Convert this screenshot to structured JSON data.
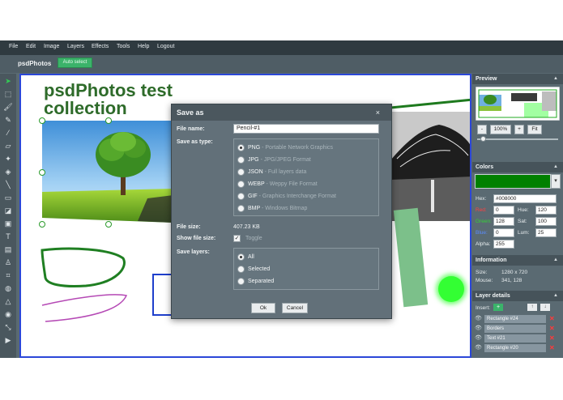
{
  "menu": [
    "File",
    "Edit",
    "Image",
    "Layers",
    "Effects",
    "Tools",
    "Help",
    "Logout"
  ],
  "app": {
    "brand": "psdPhotos",
    "auto_select": "Auto select"
  },
  "canvas": {
    "title_line1": "psdPhotos test",
    "title_line2": "collection"
  },
  "tools": [
    "select-icon",
    "marquee-icon",
    "brush-icon",
    "pencil-icon",
    "pipette-icon",
    "eraser-icon",
    "magic-wand-icon",
    "fill-icon",
    "line-icon",
    "rectangle-icon",
    "gradient-icon",
    "image-icon",
    "text-icon",
    "gradient-fill-icon",
    "stamp-icon",
    "crop-icon",
    "blur-icon",
    "sharpen-icon",
    "desaturate-icon",
    "bulge-icon",
    "animate-icon"
  ],
  "preview": {
    "title": "Preview",
    "minus": "-",
    "zoom": "100%",
    "plus": "+",
    "fit": "Fit",
    "zoom_level": 1.0
  },
  "colors": {
    "title": "Colors",
    "swatch": "#008000",
    "hex_label": "Hex:",
    "hex": "#008000",
    "red_label": "Red:",
    "red": "0",
    "green_label": "Green:",
    "green": "128",
    "blue_label": "Blue:",
    "blue": "0",
    "alpha_label": "Alpha:",
    "alpha": "255",
    "hue_label": "Hue:",
    "hue": "120",
    "sat_label": "Sat:",
    "sat": "100",
    "lum_label": "Lum:",
    "lum": "25"
  },
  "information": {
    "title": "Information",
    "size_label": "Size:",
    "size": "1280 x 720",
    "mouse_label": "Mouse:",
    "mouse": "341, 128"
  },
  "layers": {
    "title": "Layer details",
    "insert_label": "Insert:",
    "items": [
      {
        "name": "Rectangle #24"
      },
      {
        "name": "Borders"
      },
      {
        "name": "Text #21"
      },
      {
        "name": "Rectangle #20"
      }
    ]
  },
  "dialog": {
    "title": "Save as",
    "close": "×",
    "file_name_label": "File name:",
    "file_name": "Pencil-#1",
    "save_as_type_label": "Save as type:",
    "types": [
      {
        "name": "PNG",
        "desc": " - Portable Network Graphics",
        "selected": true
      },
      {
        "name": "JPG",
        "desc": " - JPG/JPEG Format",
        "selected": false
      },
      {
        "name": "JSON",
        "desc": " - Full layers data",
        "selected": false
      },
      {
        "name": "WEBP",
        "desc": " - Weppy File Format",
        "selected": false
      },
      {
        "name": "GIF",
        "desc": " - Graphics Interchange Format",
        "selected": false
      },
      {
        "name": "BMP",
        "desc": " - Windows Bitmap",
        "selected": false
      }
    ],
    "file_size_label": "File size:",
    "file_size": "407.23 KB",
    "show_file_size_label": "Show file size:",
    "toggle_label": "Toggle",
    "toggle_checked": true,
    "save_layers_label": "Save layers:",
    "layer_options": [
      {
        "name": "All",
        "selected": true
      },
      {
        "name": "Selected",
        "selected": false
      },
      {
        "name": "Separated",
        "selected": false
      }
    ],
    "ok": "Ok",
    "cancel": "Cancel"
  }
}
